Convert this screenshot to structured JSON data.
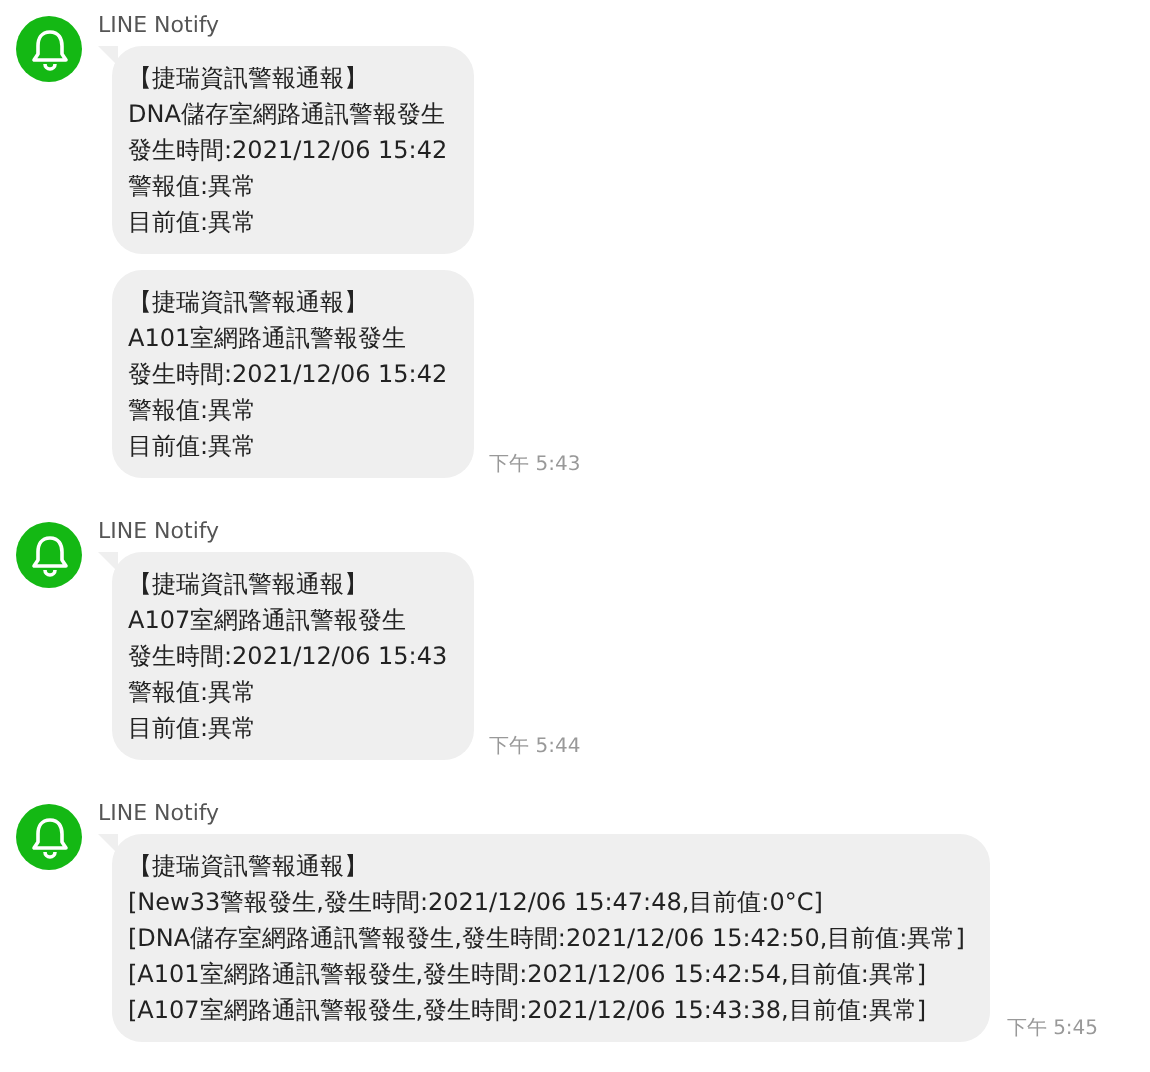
{
  "groups": [
    {
      "sender": "LINE Notify",
      "messages": [
        {
          "lines": [
            "【捷瑞資訊警報通報】",
            "DNA儲存室網路通訊警報發生",
            "發生時間:2021/12/06 15:42",
            "警報值:異常",
            "目前值:異常"
          ]
        },
        {
          "lines": [
            "【捷瑞資訊警報通報】",
            "A101室網路通訊警報發生",
            "發生時間:2021/12/06 15:42",
            "警報值:異常",
            "目前值:異常"
          ],
          "time": "下午 5:43"
        }
      ]
    },
    {
      "sender": "LINE Notify",
      "messages": [
        {
          "lines": [
            "【捷瑞資訊警報通報】",
            "A107室網路通訊警報發生",
            "發生時間:2021/12/06 15:43",
            "警報值:異常",
            "目前值:異常"
          ],
          "time": "下午 5:44"
        }
      ]
    },
    {
      "sender": "LINE Notify",
      "messages": [
        {
          "lines": [
            "【捷瑞資訊警報通報】",
            "[New33警報發生,發生時間:2021/12/06 15:47:48,目前值:0°C]",
            "[DNA儲存室網路通訊警報發生,發生時間:2021/12/06 15:42:50,目前值:異常]",
            "[A101室網路通訊警報發生,發生時間:2021/12/06 15:42:54,目前值:異常]",
            "[A107室網路通訊警報發生,發生時間:2021/12/06 15:43:38,目前值:異常]"
          ],
          "time": "下午 5:45"
        }
      ]
    }
  ]
}
